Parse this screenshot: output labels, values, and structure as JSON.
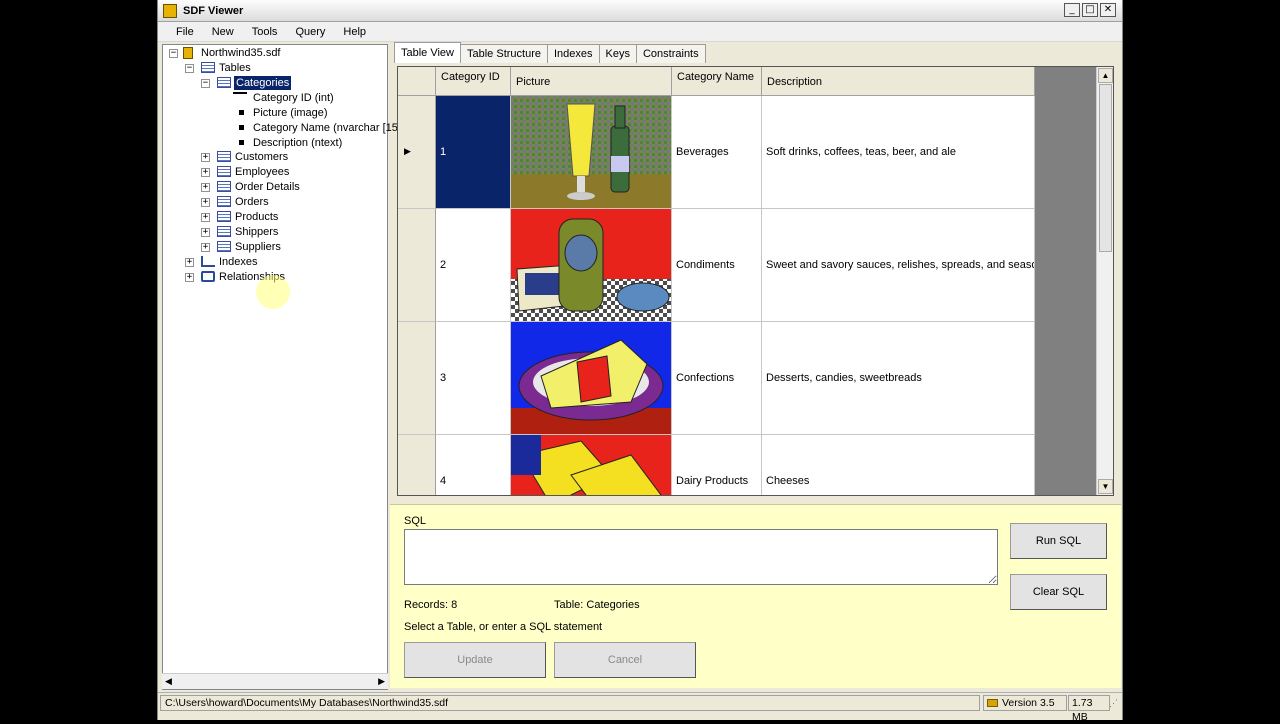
{
  "window": {
    "title": "SDF Viewer",
    "buttons": [
      "_",
      "□",
      "✕"
    ]
  },
  "menu": [
    "File",
    "New",
    "Tools",
    "Query",
    "Help"
  ],
  "tree": {
    "root": "Northwind35.sdf",
    "tables_label": "Tables",
    "selected_table": "Categories",
    "columns": [
      "Category ID (int)",
      "Picture (image)",
      "Category Name (nvarchar [15",
      "Description (ntext)"
    ],
    "tables": [
      "Customers",
      "Employees",
      "Order Details",
      "Orders",
      "Products",
      "Shippers",
      "Suppliers"
    ],
    "indexes_label": "Indexes",
    "relationships_label": "Relationships"
  },
  "tabs": [
    "Table View",
    "Table Structure",
    "Indexes",
    "Keys",
    "Constraints"
  ],
  "grid": {
    "headers": [
      "Category ID",
      "Picture",
      "Category Name",
      "Description"
    ],
    "rows": [
      {
        "id": "1",
        "name": "Beverages",
        "description": "Soft drinks, coffees, teas, beer, and ale"
      },
      {
        "id": "2",
        "name": "Condiments",
        "description": "Sweet and savory sauces, relishes, spreads, and seasonings"
      },
      {
        "id": "3",
        "name": "Confections",
        "description": "Desserts, candies, sweetbreads"
      },
      {
        "id": "4",
        "name": "Dairy Products",
        "description": "Cheeses"
      }
    ]
  },
  "sql": {
    "label": "SQL",
    "value": "",
    "run_label": "Run SQL",
    "clear_label": "Clear SQL",
    "records": "Records: 8",
    "table": "Table: Categories",
    "hint": "Select a Table, or enter a SQL statement",
    "update_label": "Update",
    "cancel_label": "Cancel"
  },
  "status": {
    "path": "C:\\Users\\howard\\Documents\\My Databases\\Northwind35.sdf",
    "version": "Version 3.5",
    "size": "1.73 MB"
  }
}
